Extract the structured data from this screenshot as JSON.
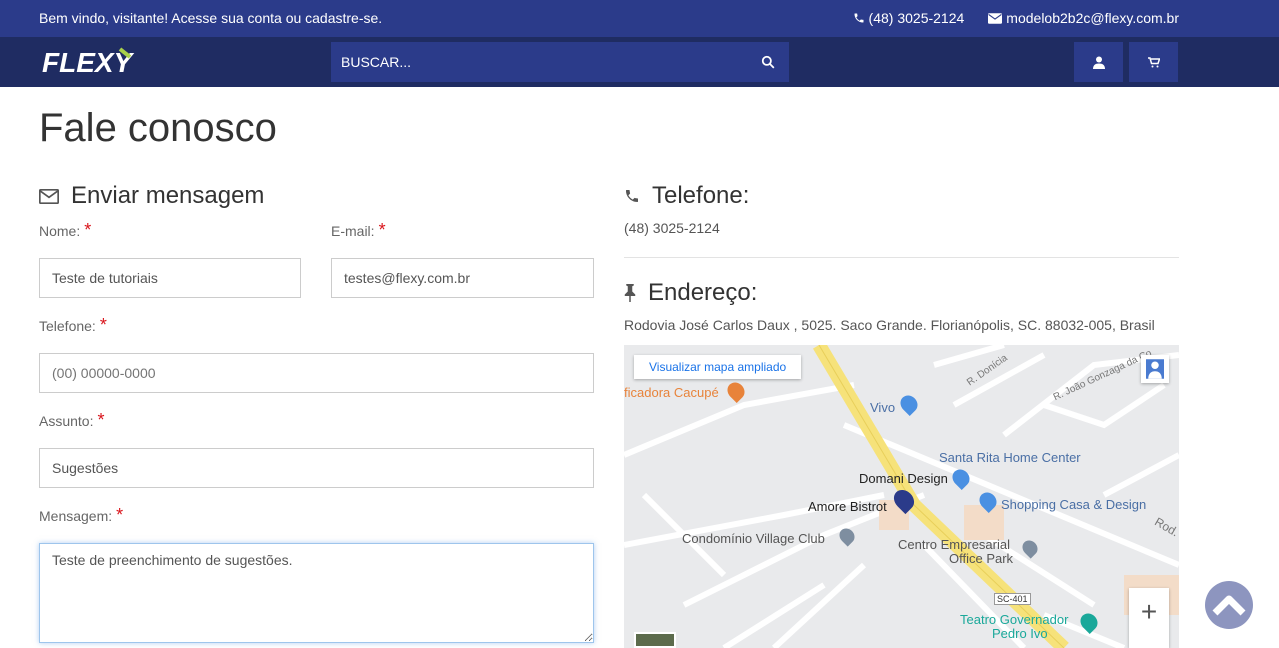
{
  "topbar": {
    "welcome": "Bem vindo, visitante! Acesse sua conta ou cadastre-se.",
    "phone": "(48) 3025-2124",
    "email": "modelob2b2c@flexy.com.br"
  },
  "navbar": {
    "logo_text": "FLEXY",
    "search_placeholder": "BUSCAR...",
    "icons": [
      "search-icon",
      "user-icon",
      "cart-icon"
    ]
  },
  "page": {
    "title": "Fale conosco"
  },
  "form": {
    "heading": "Enviar mensagem",
    "required_mark": "*",
    "name": {
      "label": "Nome:",
      "value": "Teste de tutoriais"
    },
    "email": {
      "label": "E-mail:",
      "value": "testes@flexy.com.br"
    },
    "phone": {
      "label": "Telefone:",
      "placeholder": "(00) 00000-0000"
    },
    "subject": {
      "label": "Assunto:",
      "value": "Sugestões"
    },
    "message": {
      "label": "Mensagem:",
      "value": "Teste de preenchimento de sugestões. "
    }
  },
  "contact": {
    "phone_heading": "Telefone:",
    "phone": "(48) 3025-2124",
    "address_heading": "Endereço:",
    "address": "Rodovia José Carlos Daux , 5025. Saco Grande. Florianópolis, SC. 88032-005, Brasil"
  },
  "map": {
    "view_larger": "Visualizar mapa ampliado",
    "labels": {
      "cacupe": "ficadora Cacupé",
      "vivo": "Vivo",
      "santa_rita": "Santa Rita Home Center",
      "domani": "Domani Design",
      "amore": "Amore Bistrot",
      "shopping": "Shopping Casa & Design",
      "condominio": "Condomínio Village Club",
      "centro_1": "Centro Empresarial",
      "centro_2": "Office Park",
      "teatro_1": "Teatro Governador",
      "teatro_2": "Pedro Ivo",
      "donicia": "R. Donícia",
      "joao": "R. João Gonzaga da Co",
      "rod": "Rod.",
      "sc401": "SC-401",
      "zoom_in": "+"
    },
    "colors": {
      "road_main": "#f6e27a",
      "poi_blue": "#4a90e2",
      "poi_orange": "#e8833a",
      "poi_teal": "#1aa89a"
    }
  },
  "colors": {
    "topbar": "#2b3b8a",
    "navbar": "#1f2c62",
    "required": "#d9141b"
  }
}
